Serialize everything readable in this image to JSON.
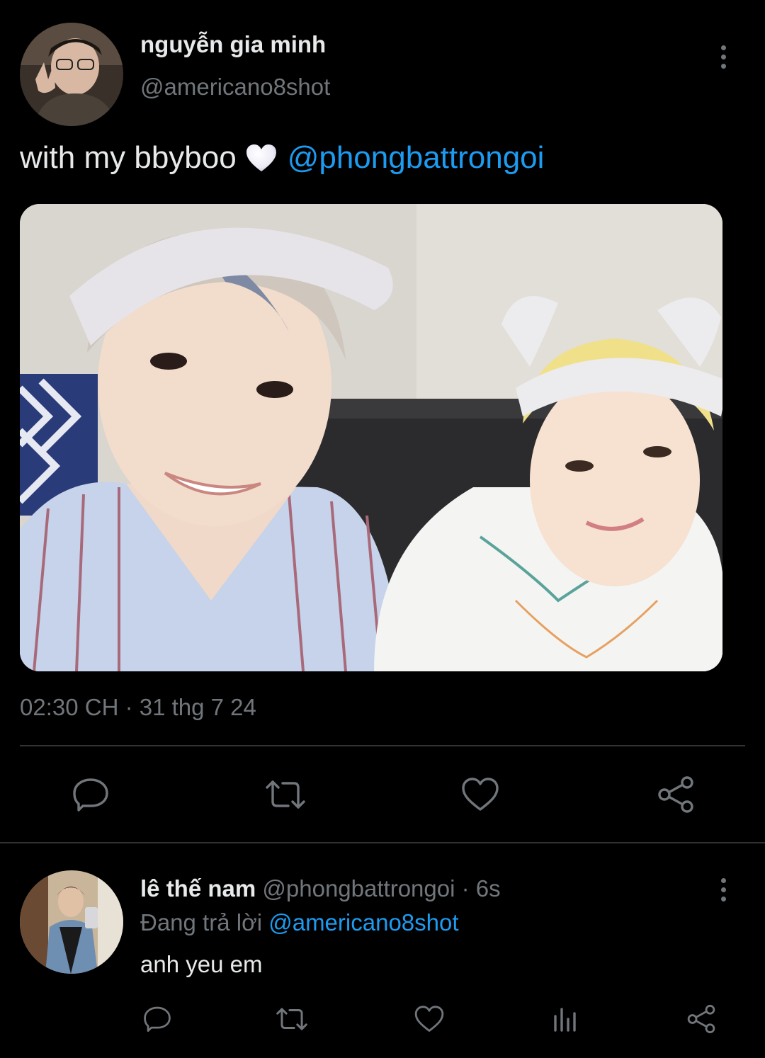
{
  "tweet": {
    "author_name": "nguyễn gia minh",
    "author_handle": "@americano8shot",
    "text": "with my bbyboo",
    "emoji": "white-heart",
    "mention": "@phongbattrongoi",
    "timestamp": "02:30 CH · 31 thg 7 24",
    "actions": [
      "reply-icon",
      "retweet-icon",
      "like-icon",
      "share-icon"
    ]
  },
  "reply": {
    "author_name": "lê thế nam",
    "author_handle": "@phongbattrongoi",
    "separator": "·",
    "time": "6s",
    "replying_prefix": "Đang trả lời",
    "replying_to": "@americano8shot",
    "text": "anh yeu em",
    "actions": [
      "reply-icon",
      "retweet-icon",
      "like-icon",
      "analytics-icon",
      "share-icon"
    ]
  },
  "colors": {
    "background": "#000000",
    "primary_text": "#e7e9ea",
    "secondary_text": "#71767b",
    "link": "#1d9bf0",
    "divider": "#2f3336"
  }
}
